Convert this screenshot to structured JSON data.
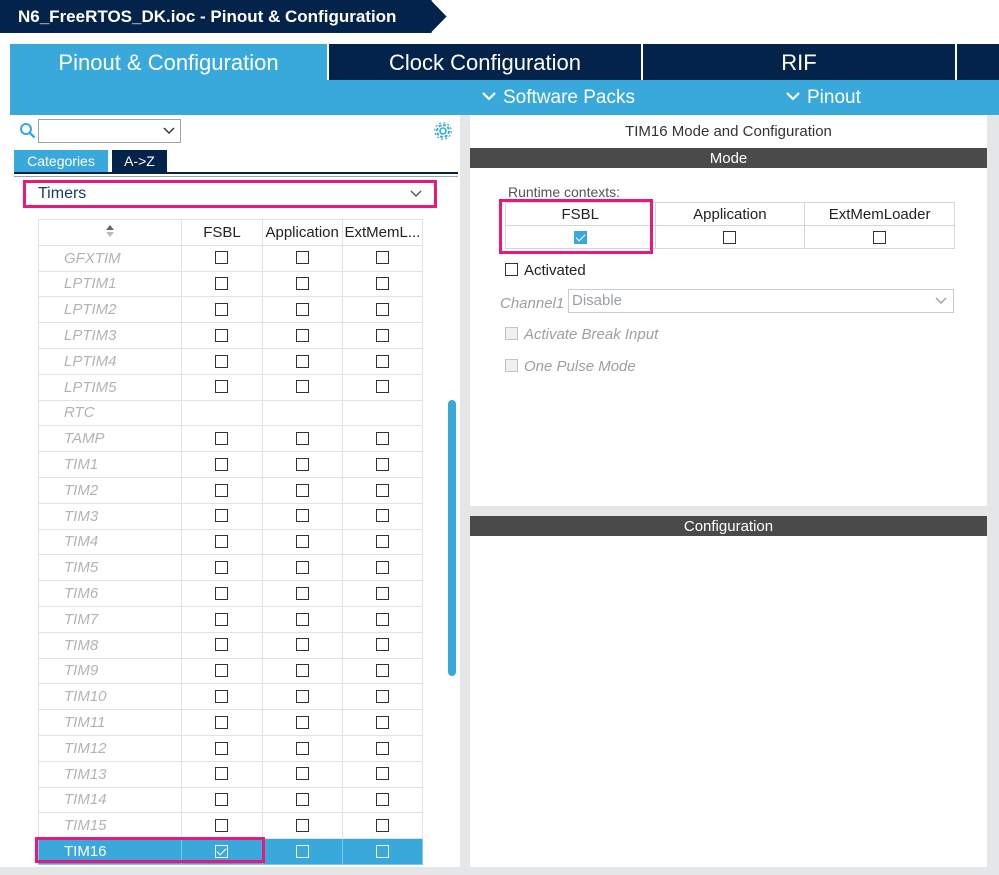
{
  "title": "N6_FreeRTOS_DK.ioc - Pinout & Configuration",
  "tabs": [
    {
      "label": "Pinout & Configuration",
      "active": true
    },
    {
      "label": "Clock Configuration",
      "active": false
    },
    {
      "label": "RIF",
      "active": false
    }
  ],
  "subnav": {
    "software_packs": "Software Packs",
    "pinout": "Pinout"
  },
  "left": {
    "search_value": "",
    "category_tabs": [
      "Categories",
      "A->Z"
    ],
    "filter_value": "Timers",
    "columns": [
      "FSBL",
      "Application",
      "ExtMemL..."
    ],
    "rows": [
      {
        "name": "GFXTIM",
        "fsbl": false,
        "app": false,
        "ext": false,
        "has_checks": true
      },
      {
        "name": "LPTIM1",
        "fsbl": false,
        "app": false,
        "ext": false,
        "has_checks": true
      },
      {
        "name": "LPTIM2",
        "fsbl": false,
        "app": false,
        "ext": false,
        "has_checks": true
      },
      {
        "name": "LPTIM3",
        "fsbl": false,
        "app": false,
        "ext": false,
        "has_checks": true
      },
      {
        "name": "LPTIM4",
        "fsbl": false,
        "app": false,
        "ext": false,
        "has_checks": true
      },
      {
        "name": "LPTIM5",
        "fsbl": false,
        "app": false,
        "ext": false,
        "has_checks": true
      },
      {
        "name": "RTC",
        "fsbl": false,
        "app": false,
        "ext": false,
        "has_checks": false
      },
      {
        "name": "TAMP",
        "fsbl": false,
        "app": false,
        "ext": false,
        "has_checks": true
      },
      {
        "name": "TIM1",
        "fsbl": false,
        "app": false,
        "ext": false,
        "has_checks": true
      },
      {
        "name": "TIM2",
        "fsbl": false,
        "app": false,
        "ext": false,
        "has_checks": true
      },
      {
        "name": "TIM3",
        "fsbl": false,
        "app": false,
        "ext": false,
        "has_checks": true
      },
      {
        "name": "TIM4",
        "fsbl": false,
        "app": false,
        "ext": false,
        "has_checks": true
      },
      {
        "name": "TIM5",
        "fsbl": false,
        "app": false,
        "ext": false,
        "has_checks": true
      },
      {
        "name": "TIM6",
        "fsbl": false,
        "app": false,
        "ext": false,
        "has_checks": true
      },
      {
        "name": "TIM7",
        "fsbl": false,
        "app": false,
        "ext": false,
        "has_checks": true
      },
      {
        "name": "TIM8",
        "fsbl": false,
        "app": false,
        "ext": false,
        "has_checks": true
      },
      {
        "name": "TIM9",
        "fsbl": false,
        "app": false,
        "ext": false,
        "has_checks": true
      },
      {
        "name": "TIM10",
        "fsbl": false,
        "app": false,
        "ext": false,
        "has_checks": true
      },
      {
        "name": "TIM11",
        "fsbl": false,
        "app": false,
        "ext": false,
        "has_checks": true
      },
      {
        "name": "TIM12",
        "fsbl": false,
        "app": false,
        "ext": false,
        "has_checks": true
      },
      {
        "name": "TIM13",
        "fsbl": false,
        "app": false,
        "ext": false,
        "has_checks": true
      },
      {
        "name": "TIM14",
        "fsbl": false,
        "app": false,
        "ext": false,
        "has_checks": true
      },
      {
        "name": "TIM15",
        "fsbl": false,
        "app": false,
        "ext": false,
        "has_checks": true
      },
      {
        "name": "TIM16",
        "fsbl": true,
        "app": false,
        "ext": false,
        "has_checks": true,
        "selected": true
      }
    ]
  },
  "right": {
    "panel_title": "TIM16 Mode and Configuration",
    "mode_header": "Mode",
    "runtime_label": "Runtime contexts:",
    "contexts": [
      {
        "label": "FSBL",
        "checked": true
      },
      {
        "label": "Application",
        "checked": false
      },
      {
        "label": "ExtMemLoader",
        "checked": false
      }
    ],
    "activated_label": "Activated",
    "channel_label": "Channel1",
    "channel_value": "Disable",
    "break_label": "Activate Break Input",
    "one_pulse_label": "One Pulse Mode",
    "config_header": "Configuration"
  },
  "colors": {
    "navy": "#03234b",
    "accent": "#39a9dc",
    "highlight": "#e8197a"
  }
}
